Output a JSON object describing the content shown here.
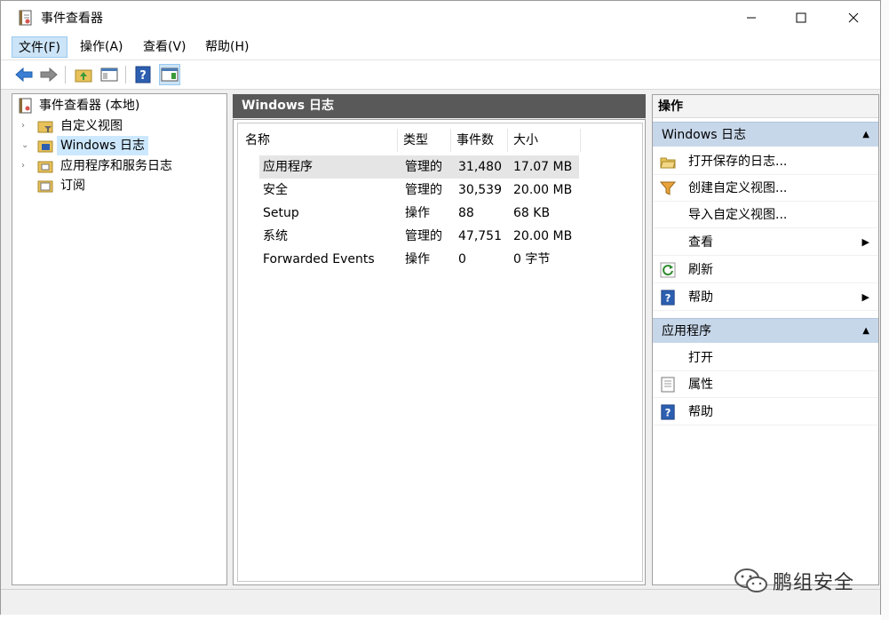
{
  "window": {
    "title": "事件查看器"
  },
  "menu": {
    "items": [
      {
        "label": "文件(F)"
      },
      {
        "label": "操作(A)"
      },
      {
        "label": "查看(V)"
      },
      {
        "label": "帮助(H)"
      }
    ]
  },
  "tree": {
    "root": "事件查看器 (本地)",
    "items": [
      {
        "label": "自定义视图"
      },
      {
        "label": "Windows 日志"
      },
      {
        "label": "应用程序和服务日志"
      },
      {
        "label": "订阅"
      }
    ]
  },
  "middle": {
    "header": "Windows 日志",
    "columns": [
      "名称",
      "类型",
      "事件数",
      "大小"
    ],
    "rows": [
      {
        "name": "应用程序",
        "type": "管理的",
        "count": "31,480",
        "size": "17.07 MB"
      },
      {
        "name": "安全",
        "type": "管理的",
        "count": "30,539",
        "size": "20.00 MB"
      },
      {
        "name": "Setup",
        "type": "操作",
        "count": "88",
        "size": "68 KB"
      },
      {
        "name": "系统",
        "type": "管理的",
        "count": "47,751",
        "size": "20.00 MB"
      },
      {
        "name": "Forwarded Events",
        "type": "操作",
        "count": "0",
        "size": "0 字节"
      }
    ]
  },
  "actions": {
    "title": "操作",
    "section1": {
      "label": "Windows 日志",
      "items": [
        {
          "label": "打开保存的日志...",
          "icon": "open-folder-icon"
        },
        {
          "label": "创建自定义视图...",
          "icon": "filter-icon"
        },
        {
          "label": "导入自定义视图...",
          "icon": ""
        },
        {
          "label": "查看",
          "icon": ""
        },
        {
          "label": "刷新",
          "icon": "refresh-icon"
        },
        {
          "label": "帮助",
          "icon": "help-icon"
        }
      ]
    },
    "section2": {
      "label": "应用程序",
      "items": [
        {
          "label": "打开",
          "icon": ""
        },
        {
          "label": "属性",
          "icon": "properties-icon"
        },
        {
          "label": "帮助",
          "icon": "help-icon"
        }
      ]
    }
  },
  "watermark": {
    "text": "鹏组安全"
  },
  "colors": {
    "accent": "#cce4f7",
    "section_bg": "#c7d7ea",
    "mid_header": "#595959"
  }
}
